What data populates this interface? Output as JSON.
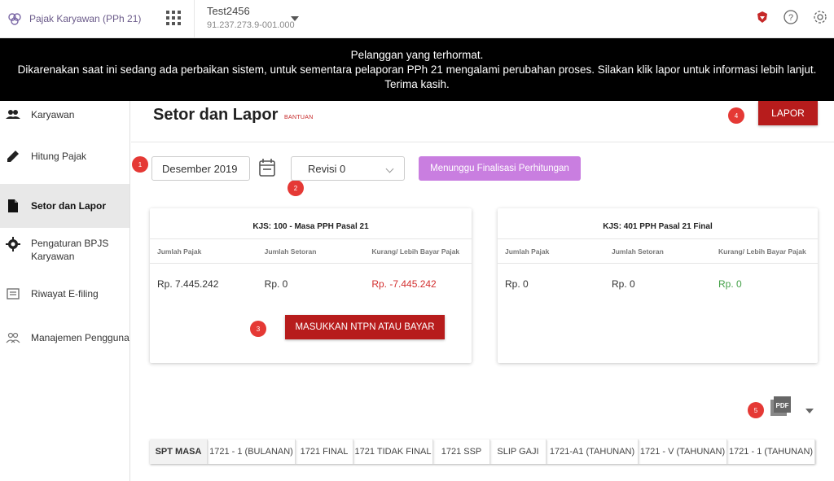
{
  "app": {
    "title": "Pajak Karyawan (PPh 21)"
  },
  "company": {
    "name": "Test2456",
    "npwp": "91.237.273.9-001.000"
  },
  "banner": {
    "line1": "Pelanggan yang terhormat.",
    "line2": "Dikarenakan saat ini sedang ada perbaikan sistem, untuk sementara pelaporan PPh 21 mengalami perubahan proses. Silakan klik lapor untuk informasi lebih lanjut.",
    "line3": "Terima kasih."
  },
  "sidebar": {
    "items": [
      {
        "label": "Karyawan",
        "icon": "people-icon"
      },
      {
        "label": "Hitung Pajak",
        "icon": "pencil-icon"
      },
      {
        "label": "Setor dan Lapor",
        "icon": "document-icon",
        "active": true
      },
      {
        "label": "Pengaturan BPJS Karyawan",
        "icon": "gear-icon"
      },
      {
        "label": "Riwayat E-filing",
        "icon": "history-icon"
      },
      {
        "label": "Manajemen Pengguna",
        "icon": "users-icon"
      }
    ]
  },
  "page": {
    "title": "Setor dan Lapor",
    "help": "BANTUAN",
    "lapor_label": "LAPOR",
    "period": "Desember 2019",
    "revisi": "Revisi 0",
    "status_label": "Menunggu Finalisasi Perhitungan",
    "ntpn_label": "MASUKKAN NTPN ATAU BAYAR",
    "markers": [
      "1",
      "2",
      "3",
      "4",
      "5"
    ]
  },
  "cards": [
    {
      "title": "KJS: 100 - Masa PPH Pasal 21",
      "headers": [
        "Jumlah Pajak",
        "Jumlah Setoran",
        "Kurang/ Lebih Bayar Pajak"
      ],
      "values": [
        "Rp. 7.445.242",
        "Rp. 0",
        "Rp. -7.445.242"
      ]
    },
    {
      "title": "KJS: 401 PPH Pasal 21 Final",
      "headers": [
        "Jumlah Pajak",
        "Jumlah Setoran",
        "Kurang/ Lebih Bayar Pajak"
      ],
      "values": [
        "Rp. 0",
        "Rp. 0",
        "Rp. 0"
      ]
    }
  ],
  "pdf": {
    "label": "PDF"
  },
  "tabs": [
    "SPT MASA",
    "1721 - 1 (BULANAN)",
    "1721 FINAL",
    "1721 TIDAK FINAL",
    "1721 SSP",
    "SLIP GAJI",
    "1721-A1 (TAHUNAN)",
    "1721 - V (TAHUNAN)",
    "1721 - 1 (TAHUNAN)"
  ],
  "colors": {
    "accent": "#b71c1c",
    "status": "#c97ee0",
    "negative": "#d32f2f",
    "positive": "#43a047",
    "banner": "#000000"
  }
}
